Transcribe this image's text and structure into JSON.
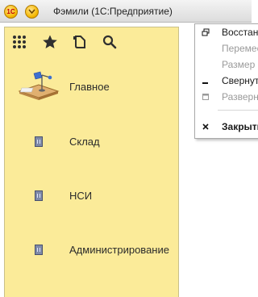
{
  "window": {
    "title": "Фэмили  (1С:Предприятие)",
    "app_logo_text": "1С"
  },
  "toolbar": {
    "buttons": [
      {
        "icon": "grid-icon"
      },
      {
        "icon": "star-icon"
      },
      {
        "icon": "history-icon"
      },
      {
        "icon": "search-icon"
      }
    ]
  },
  "sections": [
    {
      "label": "Главное",
      "icon": "desk-lamp-icon"
    },
    {
      "label": "Склад",
      "icon": "section-icon"
    },
    {
      "label": "НСИ",
      "icon": "section-icon"
    },
    {
      "label": "Администрирование",
      "icon": "section-icon"
    }
  ],
  "context_menu": {
    "items": [
      {
        "label": "Восстановить",
        "enabled": true,
        "icon": "restore-icon"
      },
      {
        "label": "Переместить",
        "enabled": false,
        "icon": ""
      },
      {
        "label": "Размер",
        "enabled": false,
        "icon": ""
      },
      {
        "label": "Свернуть",
        "enabled": true,
        "icon": "minimize-icon"
      },
      {
        "label": "Развернуть",
        "enabled": false,
        "icon": "maximize-icon"
      },
      {
        "label": "Закрыть",
        "enabled": true,
        "bold": true,
        "icon": "close-icon"
      }
    ]
  },
  "colors": {
    "panel_bg": "#fbeb99",
    "logo_yellow": "#f5b800",
    "logo_red": "#c00000"
  }
}
